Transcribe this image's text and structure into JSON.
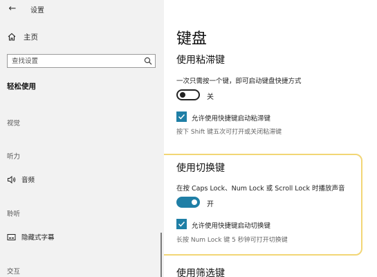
{
  "window": {
    "title": "设置",
    "back_glyph": "←"
  },
  "sidebar": {
    "home_label": "主页",
    "search_placeholder": "查找设置",
    "section_title": "轻松使用",
    "categories": {
      "vision": "视觉",
      "hearing": "听力",
      "hearing_alt": "聆听",
      "interaction": "交互"
    },
    "items": [
      {
        "label": "音频",
        "icon": "speaker-icon"
      },
      {
        "label": "隐藏式字幕",
        "icon": "captions-icon"
      }
    ]
  },
  "main": {
    "page_title": "键盘",
    "sticky_keys": {
      "heading": "使用粘滞键",
      "description": "一次只需按一个键，即可启动键盘快捷方式",
      "toggle_state": "关",
      "checkbox_label": "允许使用快捷键启动粘滞键",
      "hint": "按下 Shift 键五次可打开或关闭粘滞键"
    },
    "toggle_keys": {
      "heading": "使用切换键",
      "description": "在按 Caps Lock、Num Lock 或 Scroll Lock 时播放声音",
      "toggle_state": "开",
      "checkbox_label": "允许使用快捷键启动切换键",
      "hint": "长按 Num Lock 键 5 秒钟可打开切换键"
    },
    "filter_keys": {
      "heading": "使用筛选键"
    }
  },
  "colors": {
    "accent": "#1f7fa6",
    "highlight": "#f2d675",
    "sidebar_bg": "#f2f2f2"
  }
}
